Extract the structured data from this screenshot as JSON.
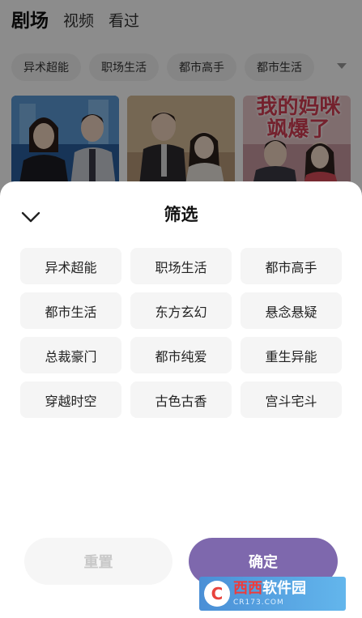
{
  "top_tabs": [
    {
      "label": "剧场",
      "active": true
    },
    {
      "label": "视频",
      "active": false
    },
    {
      "label": "看过",
      "active": false
    }
  ],
  "category_chips": [
    "异术超能",
    "职场生活",
    "都市高手",
    "都市生活"
  ],
  "chip_more_icon": "triangle-down-icon",
  "posters": [
    {
      "title": ""
    },
    {
      "title": ""
    },
    {
      "title": "我的妈咪飒爆了"
    }
  ],
  "filter_sheet": {
    "collapse_icon": "chevron-down-icon",
    "title": "筛选",
    "options": [
      "异术超能",
      "职场生活",
      "都市高手",
      "都市生活",
      "东方玄幻",
      "悬念悬疑",
      "总裁豪门",
      "都市纯爱",
      "重生异能",
      "穿越时空",
      "古色古香",
      "宫斗宅斗"
    ],
    "reset_label": "重置",
    "confirm_label": "确定"
  },
  "colors": {
    "accent": "#7e68ad",
    "option_bg": "#f5f5f5",
    "reset_text": "#c8c8c8"
  },
  "watermark": {
    "brand_prefix": "西西",
    "brand_suffix": "软件园",
    "url": "CR173.COM"
  }
}
